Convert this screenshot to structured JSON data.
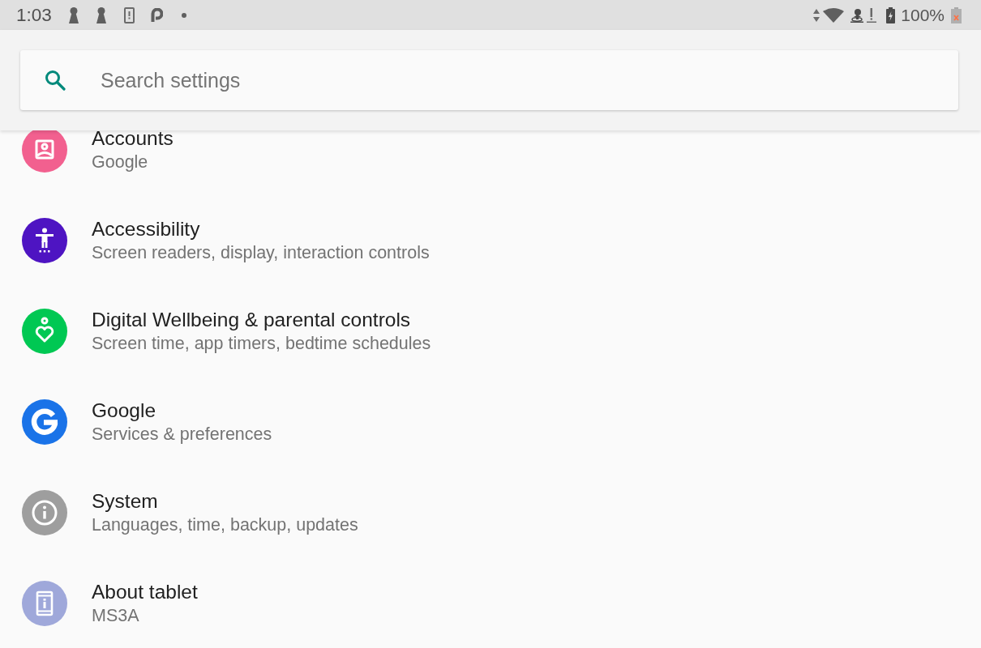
{
  "status_bar": {
    "time": "1:03",
    "battery_text": "100%"
  },
  "search": {
    "placeholder": "Search settings"
  },
  "items": [
    {
      "kind": "portrait",
      "title": "Accounts",
      "subtitle": "Google",
      "color": "#f2608f"
    },
    {
      "kind": "figure",
      "title": "Accessibility",
      "subtitle": "Screen readers, display, interaction controls",
      "color": "#4e14c2"
    },
    {
      "kind": "heart",
      "title": "Digital Wellbeing & parental controls",
      "subtitle": "Screen time, app timers, bedtime schedules",
      "color": "#00c853"
    },
    {
      "kind": "letter",
      "title": "Google",
      "subtitle": "Services & preferences",
      "color": "#1a73e8"
    },
    {
      "kind": "info",
      "title": "System",
      "subtitle": "Languages, time, backup, updates",
      "color": "#9e9e9e"
    },
    {
      "kind": "tablet",
      "title": "About tablet",
      "subtitle": "MS3A",
      "color": "#9fa8da"
    }
  ]
}
